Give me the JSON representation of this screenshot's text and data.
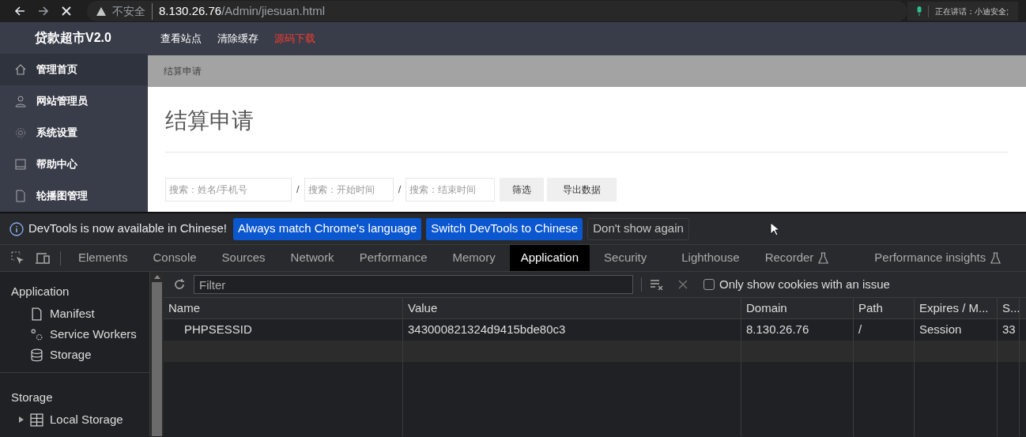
{
  "browser": {
    "security_label": "不安全",
    "url_host": "8.130.26.76",
    "url_path": "/Admin/jiesuan.html",
    "speaking_label": "正在讲话：小迪安全;"
  },
  "admin": {
    "brand": "贷款超市V2.0",
    "top_links": [
      {
        "label": "查看站点",
        "kind": "normal"
      },
      {
        "label": "清除缓存",
        "kind": "normal"
      },
      {
        "label": "源码下载",
        "kind": "highlight"
      }
    ],
    "sidebar": [
      {
        "label": "管理首页",
        "selected": true
      },
      {
        "label": "网站管理员",
        "selected": false
      },
      {
        "label": "系统设置",
        "selected": false
      },
      {
        "label": "帮助中心",
        "selected": false
      },
      {
        "label": "轮播图管理",
        "selected": false
      }
    ],
    "breadcrumb": "结算申请",
    "heading": "结算申请",
    "filters": [
      {
        "placeholder": "搜索：姓名/手机号"
      },
      {
        "placeholder": "搜索：开始时间"
      },
      {
        "placeholder": "搜索：结束时间"
      }
    ],
    "separator": "/",
    "buttons": [
      "筛选",
      "导出数据"
    ]
  },
  "devtools": {
    "info": {
      "message": "DevTools is now available in Chinese!",
      "buttons": [
        {
          "label": "Always match Chrome's language",
          "kind": "primary"
        },
        {
          "label": "Switch DevTools to Chinese",
          "kind": "primary"
        },
        {
          "label": "Don't show again",
          "kind": "plain"
        }
      ]
    },
    "tabs": [
      {
        "label": "Elements",
        "selected": false,
        "experimental": false
      },
      {
        "label": "Console",
        "selected": false,
        "experimental": false
      },
      {
        "label": "Sources",
        "selected": false,
        "experimental": false
      },
      {
        "label": "Network",
        "selected": false,
        "experimental": false
      },
      {
        "label": "Performance",
        "selected": false,
        "experimental": false
      },
      {
        "label": "Memory",
        "selected": false,
        "experimental": false
      },
      {
        "label": "Application",
        "selected": true,
        "experimental": false
      },
      {
        "label": "Security",
        "selected": false,
        "experimental": false
      },
      {
        "label": "Lighthouse",
        "selected": false,
        "experimental": false
      },
      {
        "label": "Recorder",
        "selected": false,
        "experimental": true
      },
      {
        "label": "Performance insights",
        "selected": false,
        "experimental": true
      }
    ],
    "sidebar_sections": [
      {
        "title": "Application",
        "items": [
          {
            "label": "Manifest"
          },
          {
            "label": "Service Workers"
          },
          {
            "label": "Storage"
          }
        ]
      },
      {
        "title": "Storage",
        "items": [
          {
            "label": "Local Storage"
          }
        ]
      }
    ],
    "filter_placeholder": "Filter",
    "only_issues": {
      "label": "Only show cookies with an issue",
      "checked": false
    },
    "table": {
      "columns": [
        "Name",
        "Value",
        "Domain",
        "Path",
        "Expires / M...",
        "S..."
      ],
      "rows": [
        [
          "PHPSESSID",
          "343000821324d9415bde80c3",
          "8.130.26.76",
          "/",
          "Session",
          "33"
        ]
      ]
    }
  }
}
